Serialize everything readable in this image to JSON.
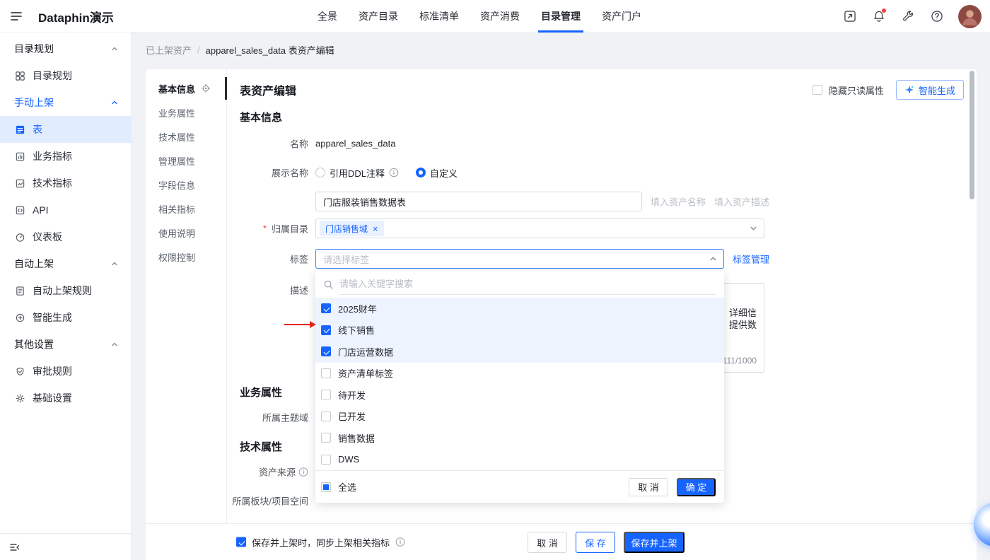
{
  "ui_colors": {
    "primary": "#1664ff",
    "annotation_arrow": "#e1251b",
    "notification_dot": "#f53f3f",
    "active_row_bg": "#e1edff"
  },
  "topnav": {
    "logo": "Dataphin演示",
    "items": [
      {
        "label": "全景"
      },
      {
        "label": "资产目录"
      },
      {
        "label": "标准清单"
      },
      {
        "label": "资产消费"
      },
      {
        "label": "目录管理",
        "active": true
      },
      {
        "label": "资产门户"
      }
    ]
  },
  "sidebar": {
    "groups": [
      {
        "header": "目录规划",
        "items": [
          {
            "label": "目录规划"
          }
        ]
      },
      {
        "header": "手动上架",
        "items": [
          {
            "label": "表",
            "active": true
          },
          {
            "label": "业务指标"
          },
          {
            "label": "技术指标"
          },
          {
            "label": "API"
          },
          {
            "label": "仪表板"
          }
        ]
      },
      {
        "header": "自动上架",
        "items": [
          {
            "label": "自动上架规则"
          },
          {
            "label": "智能生成"
          }
        ]
      },
      {
        "header": "其他设置",
        "items": [
          {
            "label": "审批规则"
          },
          {
            "label": "基础设置"
          }
        ]
      }
    ]
  },
  "breadcrumb": {
    "parent": "已上架资产",
    "separator": "/",
    "current": "apparel_sales_data 表资产编辑"
  },
  "anchor": {
    "items": [
      {
        "label": "基本信息",
        "active": true
      },
      {
        "label": "业务属性"
      },
      {
        "label": "技术属性"
      },
      {
        "label": "管理属性"
      },
      {
        "label": "字段信息"
      },
      {
        "label": "相关指标"
      },
      {
        "label": "使用说明"
      },
      {
        "label": "权限控制"
      }
    ]
  },
  "editor": {
    "title": "表资产编辑",
    "hide_readonly": "隐藏只读属性",
    "ai_button": "智能生成",
    "section_basic": "基本信息",
    "section_business": "业务属性",
    "section_tech": "技术属性",
    "name_label": "名称",
    "name_value": "apparel_sales_data",
    "display_label": "展示名称",
    "radio_ddl": "引用DDL注释",
    "radio_custom": "自定义",
    "display_value": "门店服装销售数据表",
    "hint_name": "填入资产名称",
    "hint_desc": "填入资产描述",
    "catalog_label": "归属目录",
    "catalog_tag": "门店销售域",
    "catalog_tag_close": "×",
    "tags_label": "标签",
    "tags_placeholder": "请选择标签",
    "tag_manage": "标签管理",
    "desc_label": "描述",
    "desc_fragment_1": "详细信",
    "desc_fragment_2": "提供数",
    "desc_count": "111/1000",
    "theme_label": "所属主题域",
    "source_label": "资产来源",
    "project_label": "所属板块/项目空间"
  },
  "dropdown": {
    "search_placeholder": "请输入关键字搜索",
    "options": [
      {
        "label": "2025财年",
        "checked": true
      },
      {
        "label": "线下销售",
        "checked": true
      },
      {
        "label": "门店运营数据",
        "checked": true
      },
      {
        "label": "资产清单标签",
        "checked": false
      },
      {
        "label": "待开发",
        "checked": false
      },
      {
        "label": "已开发",
        "checked": false
      },
      {
        "label": "销售数据",
        "checked": false
      },
      {
        "label": "DWS",
        "checked": false
      }
    ],
    "select_all": "全选",
    "cancel": "取 消",
    "confirm": "确 定"
  },
  "footer": {
    "sync_label": "保存并上架时，同步上架相关指标",
    "cancel": "取 消",
    "save": "保 存",
    "save_publish": "保存并上架"
  }
}
